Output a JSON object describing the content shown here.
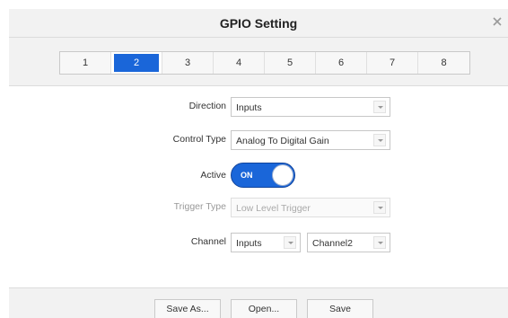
{
  "dialog": {
    "title": "GPIO Setting",
    "close_icon": "close-icon"
  },
  "tabs": [
    {
      "label": "1",
      "active": false
    },
    {
      "label": "2",
      "active": true
    },
    {
      "label": "3",
      "active": false
    },
    {
      "label": "4",
      "active": false
    },
    {
      "label": "5",
      "active": false
    },
    {
      "label": "6",
      "active": false
    },
    {
      "label": "7",
      "active": false
    },
    {
      "label": "8",
      "active": false
    }
  ],
  "form": {
    "direction": {
      "label": "Direction",
      "value": "Inputs"
    },
    "control_type": {
      "label": "Control Type",
      "value": "Analog To Digital Gain"
    },
    "active": {
      "label": "Active",
      "state": "ON"
    },
    "trigger_type": {
      "label": "Trigger Type",
      "value": "Low Level Trigger",
      "disabled": true
    },
    "channel": {
      "label": "Channel",
      "source_value": "Inputs",
      "channel_value": "Channel2"
    }
  },
  "footer": {
    "save_as": "Save As...",
    "open": "Open...",
    "save": "Save"
  },
  "colors": {
    "accent": "#1a66d9",
    "panel_bg": "#f2f2f2"
  }
}
